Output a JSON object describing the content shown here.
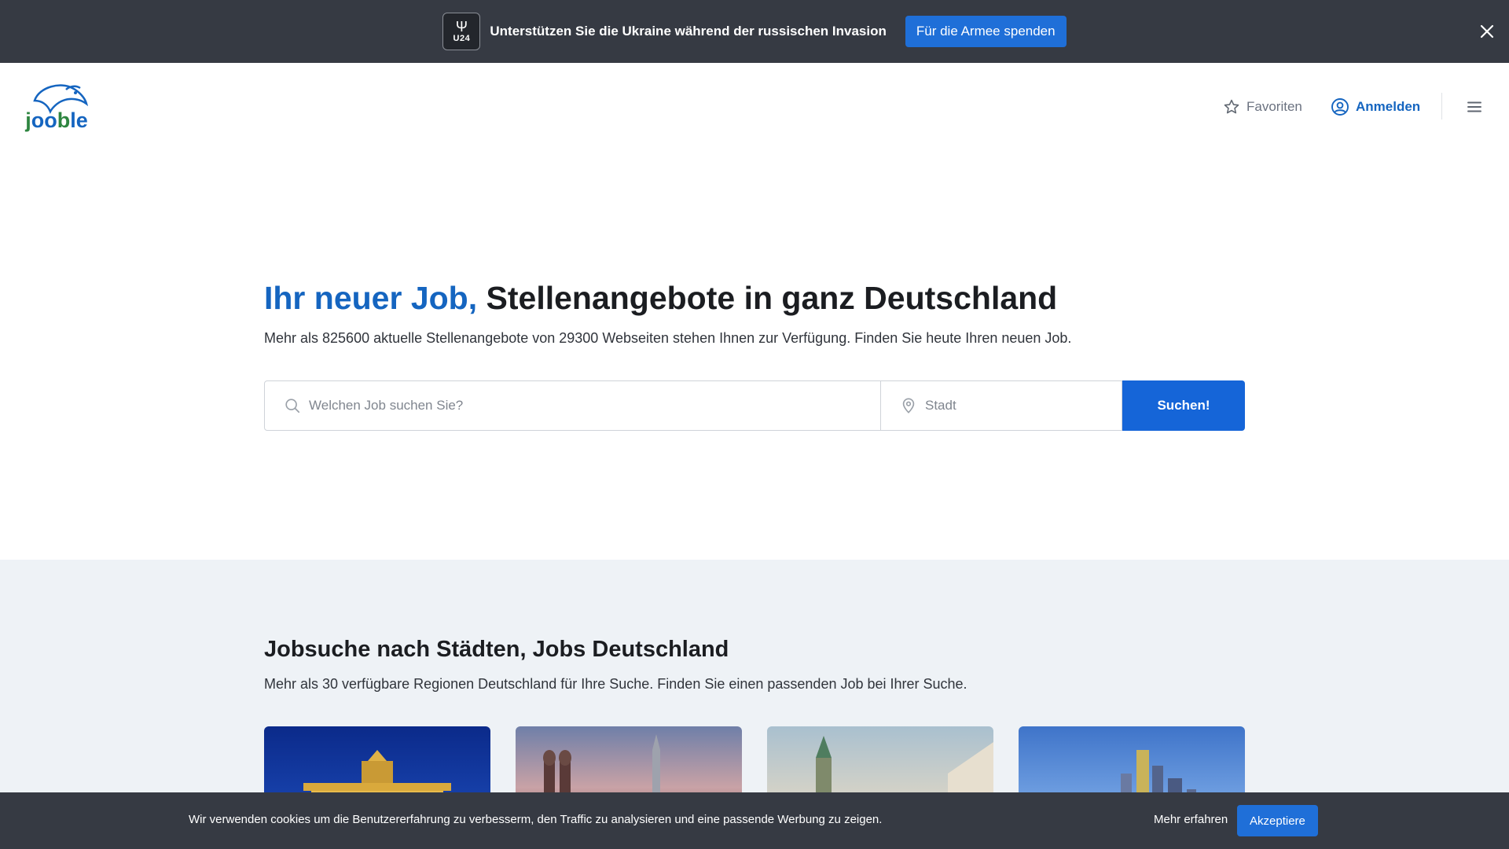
{
  "banner": {
    "logo_text": "U24",
    "message": "Unterstützen Sie die Ukraine während der russischen Invasion",
    "donate_label": "Für die Armee spenden",
    "close_icon": "close-icon"
  },
  "header": {
    "logo_text": "jooble",
    "favorites_label": "Favoriten",
    "login_label": "Anmelden",
    "menu_icon": "hamburger-menu-icon"
  },
  "hero": {
    "title_accent": "Ihr neuer Job,",
    "title_rest": "Stellenangebote in ganz Deutschland",
    "subtitle": "Mehr als 825600 aktuelle Stellenangebote von 29300 Webseiten stehen Ihnen zur Verfügung. Finden Sie heute Ihren neuen Job.",
    "job_placeholder": "Welchen Job suchen Sie?",
    "city_placeholder": "Stadt",
    "search_label": "Suchen!"
  },
  "cities": {
    "title": "Jobsuche nach Städten, Jobs Deutschland",
    "subtitle": "Mehr als 30 verfügbare Regionen Deutschland für Ihre Suche. Finden Sie einen passenden Job bei Ihrer Suche."
  },
  "cookie": {
    "text": "Wir verwenden cookies um die Benutzererfahrung zu verbesserm, den Traffic zu analysieren und eine passende Werbung zu zeigen.",
    "more_label": "Mehr erfahren",
    "accept_label": "Akzeptiere"
  },
  "colors": {
    "accent": "#1565c0",
    "banner_bg": "#363a43",
    "section_bg": "#eef2f6",
    "button_blue": "#1565d8"
  }
}
